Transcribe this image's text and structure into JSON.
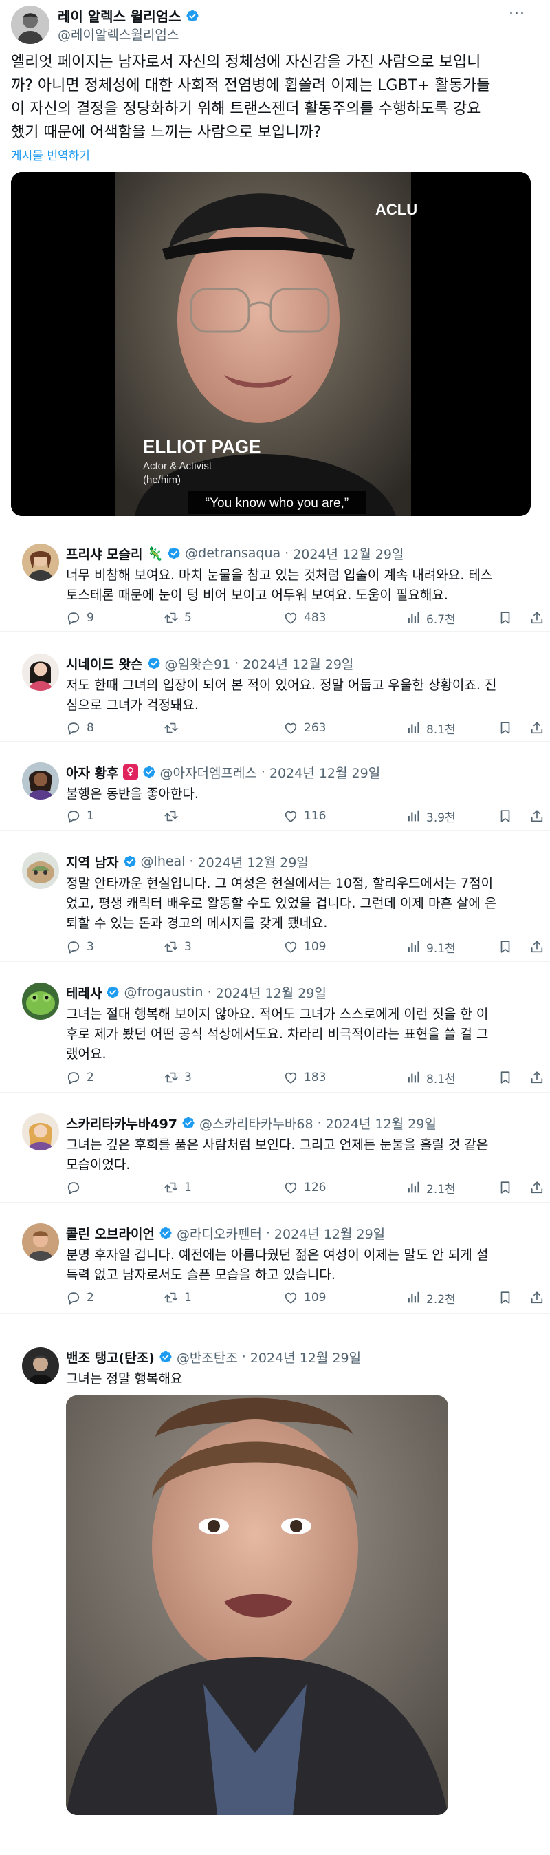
{
  "main_post": {
    "author_name": "레이 알렉스 윌리엄스",
    "handle": "@레이알렉스윌리엄스",
    "more_label": "···",
    "text": "엘리엇 페이지는 남자로서 자신의 정체성에 자신감을 가진 사람으로 보입니\n까? 아니면 정체성에 대한 사회적 전염병에 휩쓸려 이제는 LGBT+ 활동가들\n이 자신의 결정을 정당화하기 위해 트랜스젠더 활동주의를 수행하도록 강요\n했기 때문에 어색함을 느끼는 사람으로 보입니까?",
    "translate_label": "게시물 번역하기",
    "video": {
      "logo": "ACLU",
      "name_card": "ELLIOT PAGE",
      "role": "Actor & Activist",
      "pronouns": "(he/him)",
      "caption": "“You know who you are,”"
    }
  },
  "replies": [
    {
      "name": "프리샤 모슬리",
      "emoji": "🦎",
      "handle": "@detransaqua",
      "date": "2024년 12월 29일",
      "text": "너무 비참해 보여요. 마치 눈물을 참고 있는 것처럼 입술이 계속 내려와요. 테스\n토스테론 때문에 눈이 텅 비어 보이고 어두워 보여요. 도움이 필요해요.",
      "replies": "9",
      "reposts": "5",
      "likes": "483",
      "views": "6.7천"
    },
    {
      "name": "시네이드 왓슨",
      "emoji": "",
      "handle": "@임왓슨91",
      "date": "2024년 12월 29일",
      "text": "저도 한때 그녀의 입장이 되어 본 적이 있어요. 정말 어둡고 우울한 상황이죠. 진\n심으로 그녀가 걱정돼요.",
      "replies": "8",
      "reposts": "",
      "likes": "263",
      "views": "8.1천"
    },
    {
      "name": "아자 황후",
      "emoji": "♀",
      "handle": "@아자더엠프레스",
      "date": "2024년 12월 29일",
      "text": "불행은 동반을 좋아한다.",
      "replies": "1",
      "reposts": "",
      "likes": "116",
      "views": "3.9천"
    },
    {
      "name": "지역 남자",
      "emoji": "",
      "handle": "@lheal",
      "date": "2024년 12월 29일",
      "text": "정말 안타까운 현실입니다. 그 여성은 현실에서는 10점, 할리우드에서는 7점이\n었고, 평생 캐릭터 배우로 활동할 수도 있었을 겁니다. 그런데 이제 마흔 살에 은\n퇴할 수 있는 돈과 경고의 메시지를 갖게 됐네요.",
      "replies": "3",
      "reposts": "3",
      "likes": "109",
      "views": "9.1천"
    },
    {
      "name": "테레사",
      "emoji": "",
      "handle": "@frogaustin",
      "date": "2024년 12월 29일",
      "text": "그녀는 절대 행복해 보이지 않아요. 적어도 그녀가 스스로에게 이런 짓을 한 이\n후로 제가 봤던 어떤 공식 석상에서도요. 차라리 비극적이라는 표현을 쓸 걸 그\n랬어요.",
      "replies": "2",
      "reposts": "3",
      "likes": "183",
      "views": "8.1천"
    },
    {
      "name": "스카리타카누바497",
      "emoji": "",
      "handle": "@스카리타카누바68",
      "date": "2024년 12월 29일",
      "text": "그녀는 깊은 후회를 품은 사람처럼 보인다. 그리고 언제든 눈물을 흘릴 것 같은\n모습이었다.",
      "replies": "",
      "reposts": "1",
      "likes": "126",
      "views": "2.1천"
    },
    {
      "name": "콜린 오브라이언",
      "emoji": "",
      "handle": "@라디오카펜터",
      "date": "2024년 12월 29일",
      "text": "분명 후자일 겁니다. 예전에는 아름다웠던 젊은 여성이 이제는 말도 안 되게 설\n득력 없고 남자로서도 슬픈 모습을 하고 있습니다.",
      "replies": "2",
      "reposts": "1",
      "likes": "109",
      "views": "2.2천"
    },
    {
      "name": "밴조 탱고(탄조)",
      "emoji": "",
      "handle": "@반조탄조",
      "date": "2024년 12월 29일",
      "text": "그녀는 정말 행복해요"
    }
  ],
  "colors": {
    "verified": "#1d9bf0",
    "link": "#1d9bf0",
    "secondary_text": "#536471",
    "divider": "#eff3f4"
  }
}
